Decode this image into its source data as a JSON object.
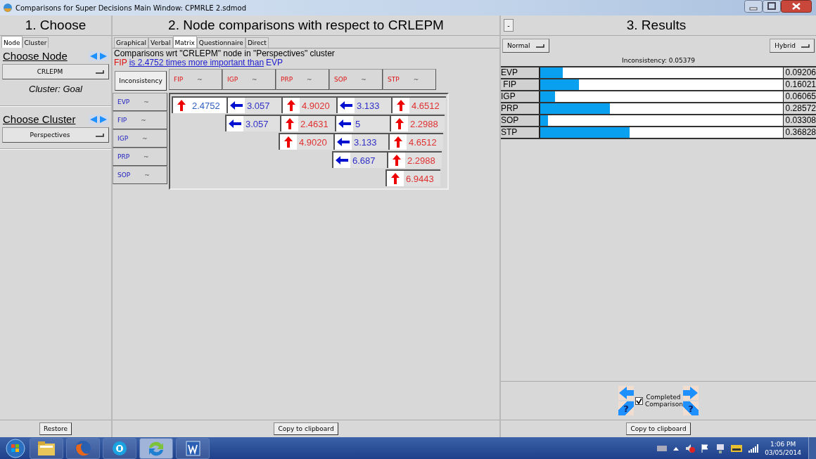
{
  "window": {
    "title": "Comparisons for Super Decisions Main Window: CPMRLE 2.sdmod"
  },
  "choose": {
    "heading": "1. Choose",
    "tabs": [
      {
        "label": "Node",
        "selected": true
      },
      {
        "label": "Cluster",
        "selected": false
      }
    ],
    "node_label": "Choose Node",
    "node_value": "CRLEPM",
    "cluster_note": "Cluster: Goal",
    "cluster_label": "Choose Cluster",
    "cluster_value": "Perspectives",
    "restore": "Restore"
  },
  "comparisons": {
    "heading": "2. Node comparisons with respect to CRLEPM",
    "tabs": [
      {
        "label": "Graphical",
        "selected": false
      },
      {
        "label": "Verbal",
        "selected": false
      },
      {
        "label": "Matrix",
        "selected": true
      },
      {
        "label": "Questionnaire",
        "selected": false
      },
      {
        "label": "Direct",
        "selected": false
      }
    ],
    "caption": "Comparisons wrt \"CRLEPM\" node in \"Perspectives\" cluster",
    "statement": {
      "left": "FIP",
      "middle": "is 2.4752 times more important than",
      "right": "EVP"
    },
    "inconsistency_button": "Inconsistency",
    "columns": [
      {
        "label": "FIP",
        "sign": "~"
      },
      {
        "label": "IGP",
        "sign": "~"
      },
      {
        "label": "PRP",
        "sign": "~"
      },
      {
        "label": "SOP",
        "sign": "~"
      },
      {
        "label": "STP",
        "sign": "~"
      }
    ],
    "rows": [
      {
        "label": "EVP",
        "sign": "~",
        "cells": [
          {
            "kind": "up",
            "value": "2.4752",
            "selected": true
          },
          {
            "kind": "left",
            "value": "3.057",
            "selected": false
          },
          {
            "kind": "up",
            "value": "4.9020",
            "selected": false
          },
          {
            "kind": "left",
            "value": "3.133",
            "selected": false
          },
          {
            "kind": "up",
            "value": "4.6512",
            "selected": false
          }
        ]
      },
      {
        "label": "FIP",
        "sign": "~",
        "cells": [
          "",
          {
            "kind": "left",
            "value": "3.057",
            "selected": false
          },
          {
            "kind": "up",
            "value": "2.4631",
            "selected": false
          },
          {
            "kind": "left",
            "value": "5",
            "selected": false
          },
          {
            "kind": "up",
            "value": "2.2988",
            "selected": false
          }
        ]
      },
      {
        "label": "IGP",
        "sign": "~",
        "cells": [
          "",
          "",
          {
            "kind": "up",
            "value": "4.9020",
            "selected": false
          },
          {
            "kind": "left",
            "value": "3.133",
            "selected": false
          },
          {
            "kind": "up",
            "value": "4.6512",
            "selected": false
          }
        ]
      },
      {
        "label": "PRP",
        "sign": "~",
        "cells": [
          "",
          "",
          "",
          {
            "kind": "left",
            "value": "6.687",
            "selected": false
          },
          {
            "kind": "up",
            "value": "2.2988",
            "selected": false
          }
        ]
      },
      {
        "label": "SOP",
        "sign": "~",
        "cells": [
          "",
          "",
          "",
          "",
          {
            "kind": "up",
            "value": "6.9443",
            "selected": false
          }
        ]
      }
    ],
    "copy": "Copy to clipboard"
  },
  "results": {
    "collapse": "-",
    "heading": "3. Results",
    "mode": "Normal",
    "view": "Hybrid",
    "inconsistency": "Inconsistency: 0.05379",
    "priorities": [
      {
        "name": "EVP",
        "level": 0.092,
        "value": "0.09206"
      },
      {
        "name": " FIP",
        "level": 0.16,
        "value": "0.16021"
      },
      {
        "name": "IGP",
        "level": 0.061,
        "value": "0.06065"
      },
      {
        "name": "PRP",
        "level": 0.286,
        "value": "0.28572"
      },
      {
        "name": "SOP",
        "level": 0.033,
        "value": "0.03308"
      },
      {
        "name": "STP",
        "level": 0.368,
        "value": "0.36828"
      }
    ],
    "help": [
      "?",
      "?"
    ],
    "completed": {
      "label": "Completed Comparison",
      "checked": true
    },
    "copy": "Copy to clipboard"
  },
  "taskbar": {
    "apps": [
      {
        "kind": "folder"
      },
      {
        "kind": "browser"
      },
      {
        "kind": "chat"
      },
      {
        "kind": "sync"
      },
      {
        "kind": "word"
      }
    ],
    "time": "1:06 PM",
    "date": "03/05/2014"
  }
}
